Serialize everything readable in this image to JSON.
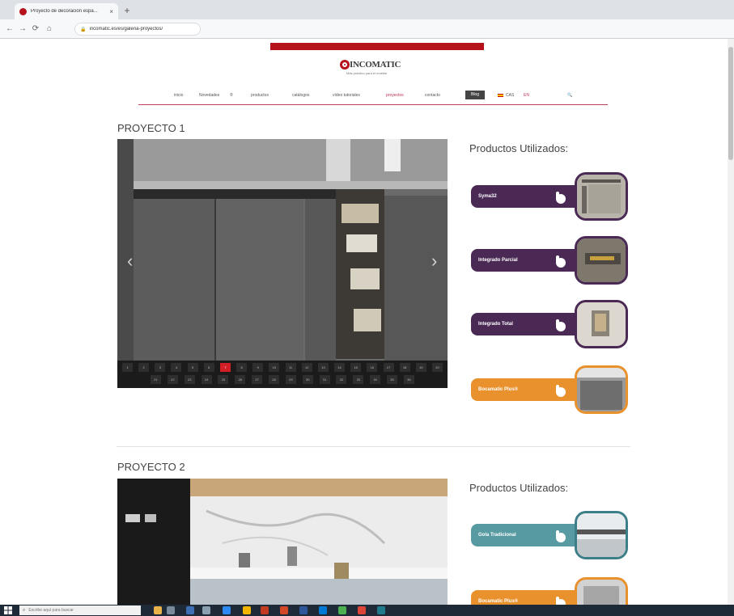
{
  "browser": {
    "tab_title": "Proyecto de decoración espa...",
    "tab_close": "×",
    "new_tab": "+",
    "url": "incomatic.es/es/galeria-proyectos/"
  },
  "site": {
    "logo_name": "INCOMATIC",
    "logo_tagline": "Más práctico para el mueble",
    "nav": [
      {
        "label": "inicio"
      },
      {
        "label": "Novedades"
      },
      {
        "label": "productos"
      },
      {
        "label": "catálogos"
      },
      {
        "label": "vídeo tutoriales"
      },
      {
        "label": "proyectos"
      },
      {
        "label": "contacto"
      },
      {
        "label": "Blog"
      },
      {
        "label": "CAS"
      },
      {
        "label": "EN"
      },
      {
        "label": "🔍"
      }
    ]
  },
  "projects": [
    {
      "title": "PROYECTO 1",
      "products_heading": "Productos Utilizados:",
      "thumb_row1": [
        "1",
        "2",
        "3",
        "4",
        "5",
        "6",
        "7",
        "8",
        "9",
        "10",
        "11",
        "12",
        "13",
        "14",
        "15",
        "16",
        "17",
        "18",
        "19",
        "20"
      ],
      "thumb_row2": [
        "21",
        "22",
        "23",
        "24",
        "25",
        "26",
        "27",
        "28",
        "29",
        "30",
        "31",
        "32",
        "33",
        "34",
        "35",
        "36"
      ],
      "current_thumb": "7",
      "products": [
        {
          "label": "Syma32"
        },
        {
          "label": "Integrado Parcial"
        },
        {
          "label": "Integrado Total"
        },
        {
          "label": "Bocamatic Plus®"
        }
      ]
    },
    {
      "title": "PROYECTO 2",
      "products_heading": "Productos Utilizados:",
      "products": [
        {
          "label": "Gola Tradicional"
        },
        {
          "label": "Bocamatic Plus®"
        }
      ]
    }
  ],
  "taskbar": {
    "search_placeholder": "Escribe aquí para buscar"
  },
  "colors": {
    "brand_red": "#b5121b",
    "purple": "#4a2a55",
    "orange": "#e8912d",
    "teal": "#579aa2"
  }
}
